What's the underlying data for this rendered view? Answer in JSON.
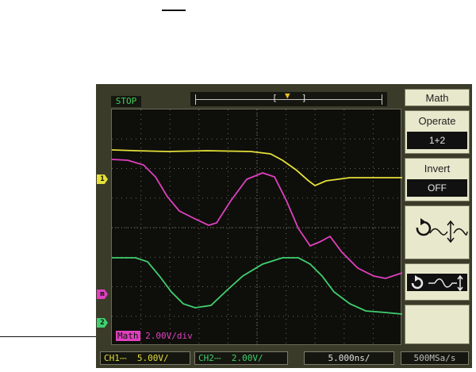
{
  "scope": {
    "status": "STOP",
    "trigger_marker": "T",
    "time_bracket_open": "[",
    "time_bracket_close": "]",
    "channel_markers": {
      "ch1": "1",
      "math": "m",
      "ch2": "2"
    },
    "math_readout": {
      "tag": "Math",
      "value": "2.00V/div"
    },
    "bottom_bar": {
      "ch1": "CH1⎓  5.00V/",
      "ch2": "CH2⎓  2.00V/",
      "timebase": "5.000ns/",
      "sample_rate": "500MSa/s"
    },
    "colors": {
      "ch1": "#e5df3a",
      "ch2": "#40d070",
      "math": "#e040c0",
      "background": "#3b3b2a",
      "grid": "#0e0f0a"
    }
  },
  "menu": {
    "title": "Math",
    "operate": {
      "label": "Operate",
      "value": "1+2"
    },
    "invert": {
      "label": "Invert",
      "value": "OFF"
    },
    "vertical_control_icon": "rotate-vertical-scale-icon",
    "horizontal_control_icon": "rotate-horizontal-position-icon"
  }
}
